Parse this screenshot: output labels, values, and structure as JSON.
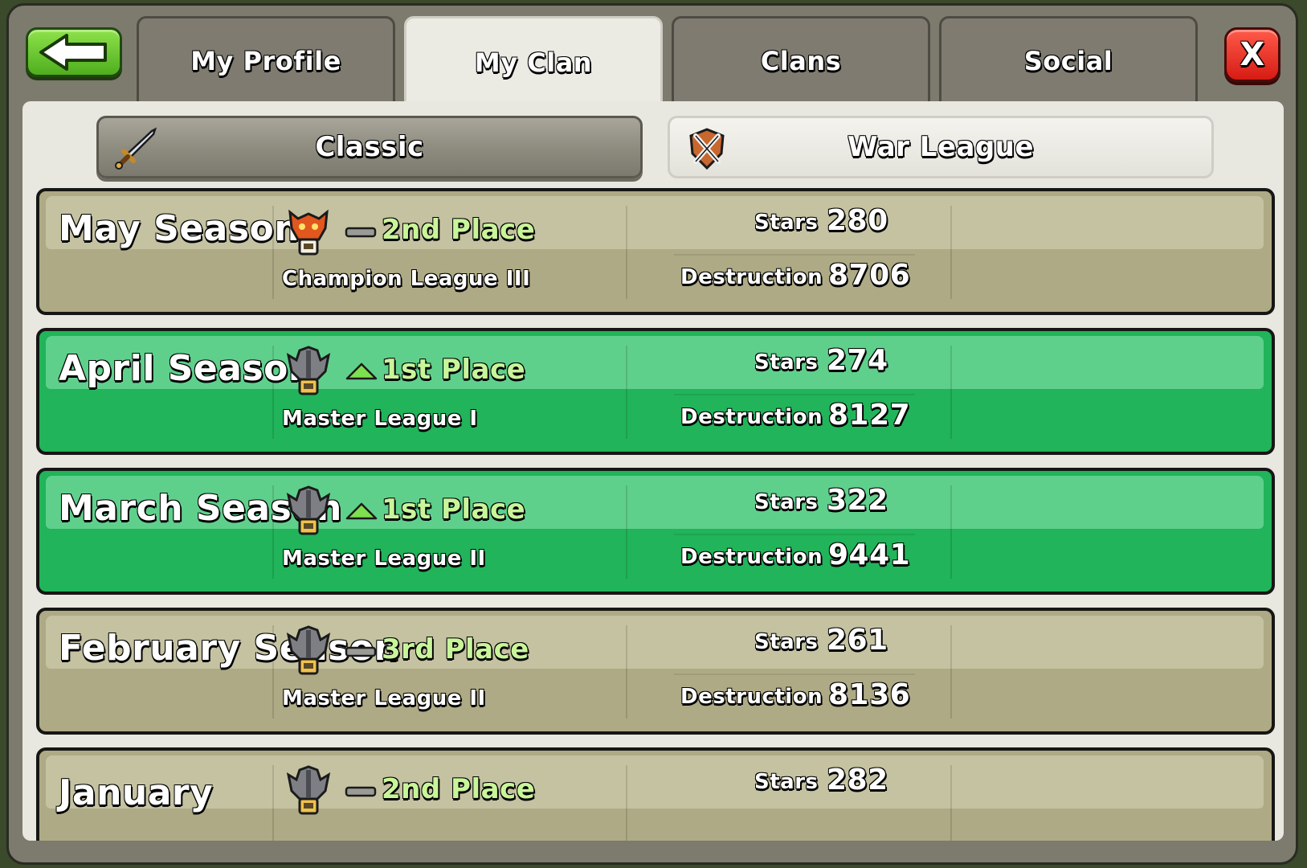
{
  "nav": {
    "tabs": [
      "My Profile",
      "My Clan",
      "Clans",
      "Social"
    ],
    "active_tab": "My Clan",
    "close_label": "X"
  },
  "subtabs": {
    "classic": "Classic",
    "war_league": "War League",
    "active": "War League"
  },
  "seasons": [
    {
      "name": "May Season",
      "place": "2nd Place",
      "trend": "same",
      "league": "Champion League III",
      "stars_label": "Stars",
      "stars": "280",
      "destruction_label": "Destruction",
      "destruction": "8706",
      "badge": "champion-league-icon"
    },
    {
      "name": "April Season",
      "place": "1st Place",
      "trend": "up",
      "league": "Master League I",
      "stars_label": "Stars",
      "stars": "274",
      "destruction_label": "Destruction",
      "destruction": "8127",
      "badge": "master-league-icon"
    },
    {
      "name": "March Season",
      "place": "1st Place",
      "trend": "up",
      "league": "Master League II",
      "stars_label": "Stars",
      "stars": "322",
      "destruction_label": "Destruction",
      "destruction": "9441",
      "badge": "master-league-icon"
    },
    {
      "name": "February Season",
      "place": "3rd Place",
      "trend": "same",
      "league": "Master League II",
      "stars_label": "Stars",
      "stars": "261",
      "destruction_label": "Destruction",
      "destruction": "8136",
      "badge": "master-league-icon"
    },
    {
      "name": "January",
      "place": "2nd Place",
      "trend": "same",
      "league": "",
      "stars_label": "Stars",
      "stars": "282",
      "destruction_label": "",
      "destruction": "",
      "badge": "master-league-icon"
    }
  ],
  "colors": {
    "promoted_row": "#21b45a",
    "neutral_row": "#aeaa85",
    "place_text": "#c9f59a"
  }
}
